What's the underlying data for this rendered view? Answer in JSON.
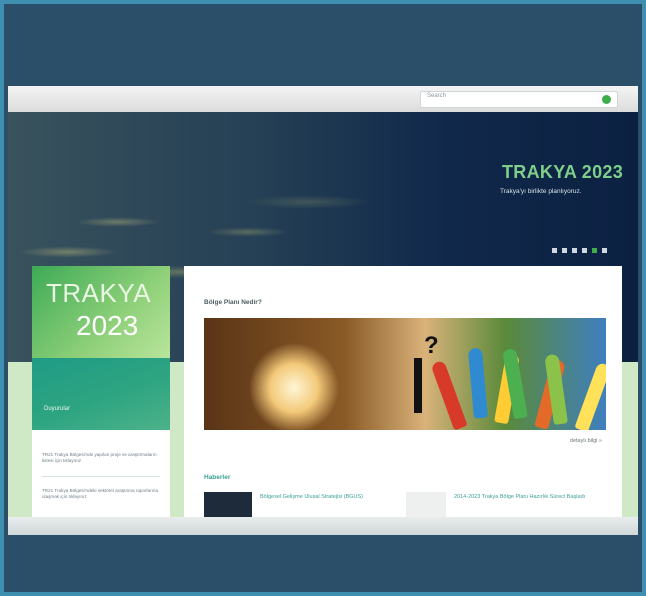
{
  "search": {
    "placeholder": "Search"
  },
  "hero": {
    "title": "TRAKYA 2023",
    "subtitle": "Trakya'yı birlikte planlıyoruz.",
    "slides_total": 6,
    "active_slide": 5
  },
  "sidebar": {
    "logo_line1": "TRAKYA",
    "logo_line2": "2023",
    "section_title": "Duyurular",
    "items": [
      "TR21 Trakya Bölgesi'nde yapılan proje ve araştırmaların listesi için tıklayınız",
      "TR21 Trakya Bölgesi'ndeki sektörel araştırma raporlarına ulaşmak için tıklayınız"
    ]
  },
  "main": {
    "heading": "Bölge Planı Nedir?",
    "detail_link": "detaylı bilgi »",
    "news_title": "Haberler",
    "news": [
      "Bölgesel Gelişme Ulusal Stratejisi (BGUS)",
      "2014-2023 Trakya Bölge Planı Hazırlık Süreci Başladı"
    ]
  },
  "colors": {
    "accent": "#3fae4a",
    "teal": "#3a9f95",
    "navy": "#10284a"
  }
}
